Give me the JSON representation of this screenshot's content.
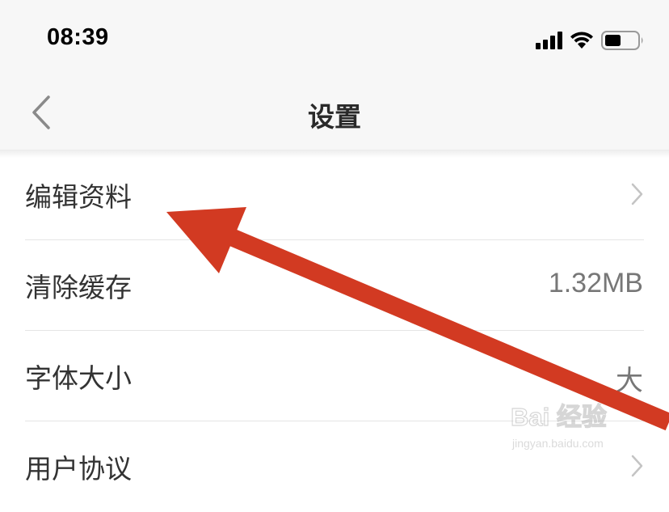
{
  "status_bar": {
    "time": "08:39",
    "icons": [
      "signal-icon",
      "wifi-icon",
      "battery-icon"
    ]
  },
  "nav": {
    "title": "设置",
    "back_icon": "back-chevron-icon"
  },
  "settings": {
    "items": [
      {
        "label": "编辑资料",
        "value": "",
        "icon": "chevron-right-icon"
      },
      {
        "label": "清除缓存",
        "value": "1.32MB",
        "icon": ""
      },
      {
        "label": "字体大小",
        "value": "大",
        "icon": ""
      },
      {
        "label": "用户协议",
        "value": "",
        "icon": "chevron-right-icon"
      }
    ]
  },
  "watermark": {
    "logo_text": "Bai 经验",
    "url": "jingyan.baidu.com"
  },
  "annotation": {
    "type": "arrow",
    "color": "#d23a22",
    "points_to": "编辑资料"
  }
}
